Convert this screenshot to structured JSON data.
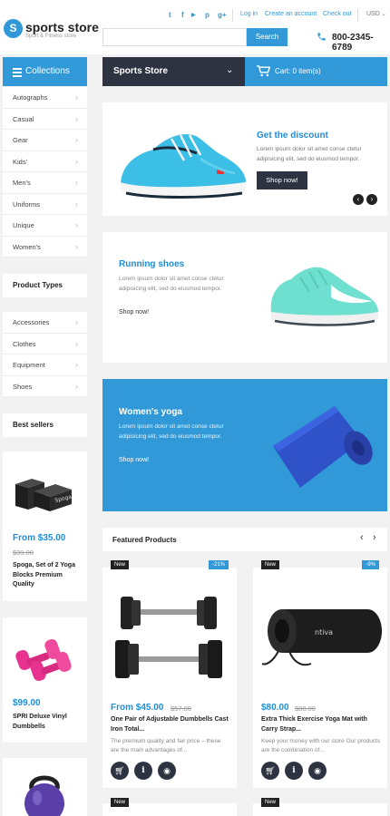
{
  "header": {
    "logo_letter": "S",
    "logo_name": "sports store",
    "logo_tagline": "Sport & Fitness store",
    "social_icons": [
      "twitter-icon",
      "facebook-icon",
      "youtube-icon",
      "pinterest-icon",
      "google-plus-icon"
    ],
    "social_glyphs": [
      "t",
      "f",
      "▶",
      "p",
      "g+"
    ],
    "links": [
      "Log in",
      "Create an account",
      "Check out"
    ],
    "currency": "USD",
    "search_button": "Search",
    "search_placeholder": "",
    "phone": "800-2345-6789"
  },
  "nav": {
    "collections": "Collections",
    "store_menu": "Sports Store",
    "cart": "Cart: 0 item(s)"
  },
  "sidebar": {
    "collections": [
      "Autographs",
      "Casual",
      "Gear",
      "Kids'",
      "Men's",
      "Uniforms",
      "Unique",
      "Women's"
    ],
    "product_types_title": "Product Types",
    "product_types": [
      "Accessories",
      "Clothes",
      "Equipment",
      "Shoes"
    ],
    "best_sellers_title": "Best sellers",
    "best_sellers": [
      {
        "price": "From $35.00",
        "old_price": "$39.00",
        "name": "Spoga, Set of 2 Yoga Blocks Premium Quality"
      },
      {
        "price": "$99.00",
        "old_price": "",
        "name": "SPRI Deluxe Vinyl Dumbbells"
      }
    ]
  },
  "banners": {
    "discount": {
      "title": "Get the discount",
      "text": "Lorem ipsum dolor sit amet conse ctetur adipisicing elit, sed do eiusmod tempor.",
      "button": "Shop now!"
    },
    "running": {
      "title": "Running shoes",
      "text": "Lorem ipsum dolor sit amet conse ctetur adipisicing elit, sed do eiusmod tempor.",
      "link": "Shop now!"
    },
    "yoga": {
      "title": "Women's yoga",
      "text": "Lorem ipsum dolor sit amet conse ctetur adipisicing elit, sed do eiusmod tempor.",
      "link": "Shop now!"
    }
  },
  "featured": {
    "title": "Featured Products",
    "badge_new": "New",
    "products": [
      {
        "discount": "-21%",
        "price": "From $45.00",
        "old_price": "$57.00",
        "name": "One Pair of Adjustable Dumbbells Cast Iron Total...",
        "desc": "The premium quality and fair price – these are the main advantages of..."
      },
      {
        "discount": "-9%",
        "price": "$80.00",
        "old_price": "$88.00",
        "name": "Extra Thick Exercise Yoga Mat with Carry Strap...",
        "desc": "Keep your money with our store Our products are the combination of..."
      }
    ]
  },
  "colors": {
    "accent": "#3199d8",
    "dark": "#2d3340",
    "price": "#1c8fd8"
  }
}
